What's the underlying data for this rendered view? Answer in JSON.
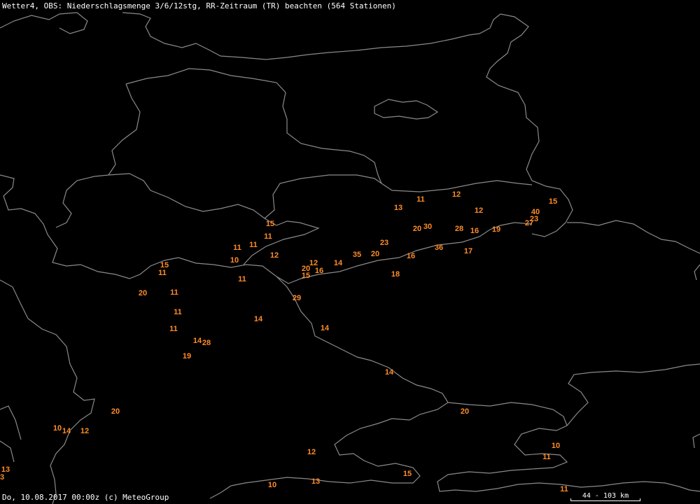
{
  "header": {
    "title": "Wetter4, OBS: Niederschlagsmenge 3/6/12stg, RR-Zeitraum (TR) beachten (564 Stationen)"
  },
  "footer": {
    "timestamp": "Do, 10.08.2017 00:00z (c) MeteoGroup"
  },
  "scale": {
    "label": "44 - 103 km"
  },
  "colors": {
    "background": "#000000",
    "borders": "#8a8a8a",
    "values": "#ff8c28",
    "text": "#ffffff"
  },
  "stations": [
    {
      "v": "15"
    },
    {
      "v": "11"
    },
    {
      "v": "12"
    },
    {
      "v": "13"
    },
    {
      "v": "12"
    },
    {
      "v": "40"
    },
    {
      "v": "23"
    },
    {
      "v": "27"
    },
    {
      "v": "20"
    },
    {
      "v": "30"
    },
    {
      "v": "28"
    },
    {
      "v": "16"
    },
    {
      "v": "19"
    },
    {
      "v": "23"
    },
    {
      "v": "35"
    },
    {
      "v": "20"
    },
    {
      "v": "36"
    },
    {
      "v": "17"
    },
    {
      "v": "16"
    },
    {
      "v": "18"
    },
    {
      "v": "15"
    },
    {
      "v": "11"
    },
    {
      "v": "11"
    },
    {
      "v": "11"
    },
    {
      "v": "12"
    },
    {
      "v": "10"
    },
    {
      "v": "11"
    },
    {
      "v": "12"
    },
    {
      "v": "14"
    },
    {
      "v": "20"
    },
    {
      "v": "16"
    },
    {
      "v": "15"
    },
    {
      "v": "15"
    },
    {
      "v": "11"
    },
    {
      "v": "20"
    },
    {
      "v": "11"
    },
    {
      "v": "29"
    },
    {
      "v": "11"
    },
    {
      "v": "14"
    },
    {
      "v": "11"
    },
    {
      "v": "14"
    },
    {
      "v": "14"
    },
    {
      "v": "28"
    },
    {
      "v": "19"
    },
    {
      "v": "14"
    },
    {
      "v": "20"
    },
    {
      "v": "20"
    },
    {
      "v": "10"
    },
    {
      "v": "14"
    },
    {
      "v": "12"
    },
    {
      "v": "12"
    },
    {
      "v": "10"
    },
    {
      "v": "11"
    },
    {
      "v": "13"
    },
    {
      "v": "3"
    },
    {
      "v": "15"
    },
    {
      "v": "13"
    },
    {
      "v": "10"
    },
    {
      "v": "11"
    }
  ]
}
